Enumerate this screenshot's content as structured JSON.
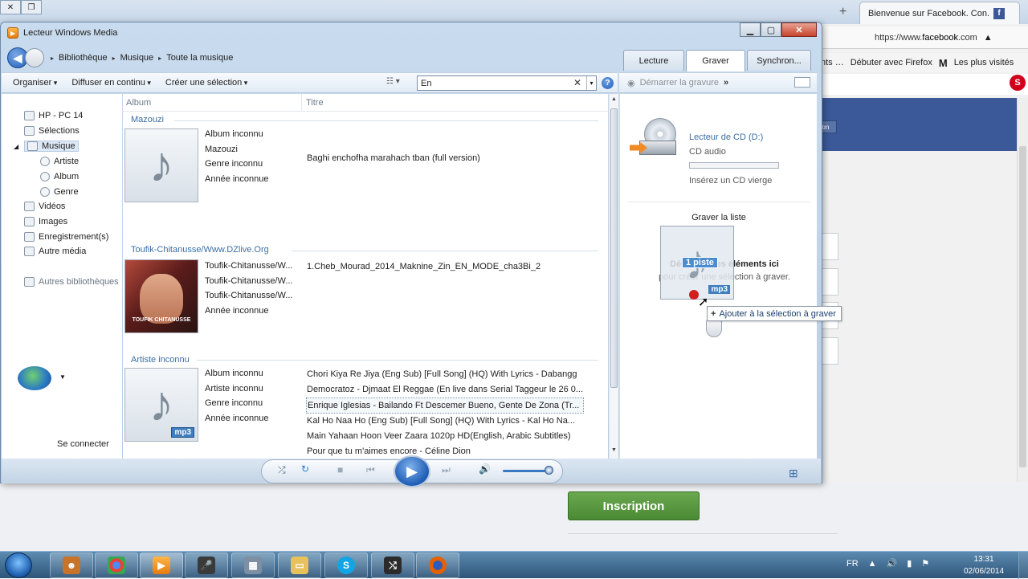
{
  "browser": {
    "tab_title": "Bienvenue sur Facebook. Con...",
    "url_prefix": "https://www.",
    "url_domain": "facebook",
    "url_suffix": ".com",
    "bookmarks": [
      "Débuter avec Firefox",
      "Les plus visités"
    ],
    "fb_button": "Inscription",
    "fb_header_btn": "ion"
  },
  "wmp": {
    "title": "Lecteur Windows Media",
    "breadcrumb": [
      "Bibliothèque",
      "Musique",
      "Toute la musique"
    ],
    "tabs": [
      "Lecture",
      "Graver",
      "Synchron..."
    ],
    "commands": [
      "Organiser",
      "Diffuser en continu",
      "Créer une sélection"
    ],
    "search_value": "En",
    "burn_command": "Démarrer la gravure",
    "nav": {
      "hp": "HP - PC 14",
      "selections": "Sélections",
      "musique": "Musique",
      "artiste": "Artiste",
      "album": "Album",
      "genre": "Genre",
      "videos": "Vidéos",
      "images": "Images",
      "enregistrements": "Enregistrement(s)",
      "autre": "Autre média",
      "autres_biblio": "Autres bibliothèques",
      "connect": "Se connecter"
    },
    "columns": {
      "album": "Album",
      "titre": "Titre"
    },
    "groups": [
      {
        "artist": "Mazouzi",
        "meta": [
          "Album inconnu",
          "Mazouzi",
          "Genre inconnu",
          "Année inconnue"
        ],
        "titles": [
          "Baghi enchofha marahach tban (full version)"
        ]
      },
      {
        "artist": "Toufik-Chitanusse/Www.DZlive.Org",
        "meta": [
          "Toufik-Chitanusse/W...",
          "Toufik-Chitanusse/W...",
          "Toufik-Chitanusse/W...",
          "Année inconnue"
        ],
        "titles": [
          "1.Cheb_Mourad_2014_Maknine_Zin_EN_MODE_cha3Bi_2"
        ],
        "art_caption": "TOUFIK CHITANUSSE"
      },
      {
        "artist": "Artiste inconnu",
        "meta": [
          "Album inconnu",
          "Artiste inconnu",
          "Genre inconnu",
          "Année inconnue"
        ],
        "titles": [
          "Chori Kiya Re Jiya (Eng Sub) [Full Song] (HQ) With Lyrics - Dabangg",
          "Democratoz - Djmaat El Reggae (En live dans Serial Taggeur le 26 0...",
          "Enrique Iglesias - Bailando Ft  Descemer Bueno, Gente De Zona (Tr...",
          "Kal Ho Naa Ho (Eng Sub) [Full Song] (HQ) With Lyrics - Kal Ho Na...",
          "Main Yahaan Hoon  Veer Zaara 1020p HD(English, Arabic Subtitles)",
          "Pour que tu m'aimes encore - Céline Dion"
        ]
      }
    ],
    "burn": {
      "drive_name": "Lecteur de CD (D:)",
      "drive_type": "CD audio",
      "insert": "Insérez un CD vierge",
      "list_title": "Graver la liste",
      "drop_title": "Déplacez des éléments ici",
      "drop_sub": "pour créer une sélection à graver.",
      "drag_badge": "1 piste",
      "drag_type": "mp3",
      "tooltip": "Ajouter à la sélection à graver"
    }
  },
  "taskbar": {
    "lang": "FR",
    "time": "13:31",
    "date": "02/06/2014"
  }
}
